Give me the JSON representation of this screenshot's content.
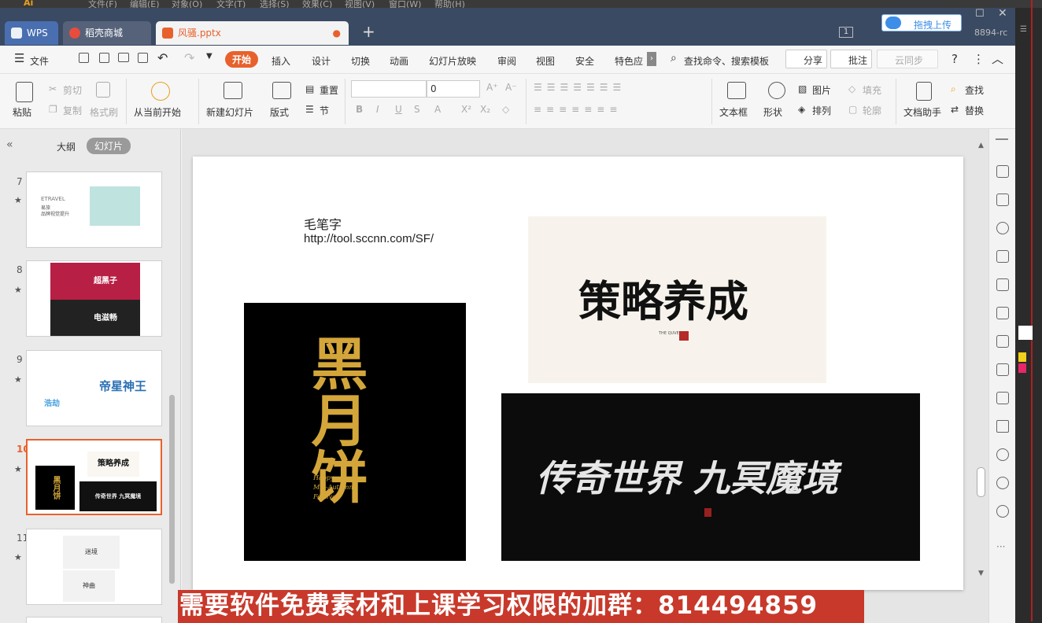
{
  "top_app_menu": [
    "文件(F)",
    "编辑(E)",
    "对象(O)",
    "文字(T)",
    "选择(S)",
    "效果(C)",
    "视图(V)",
    "窗口(W)",
    "帮助(H)"
  ],
  "tabs": [
    {
      "label": "WPS"
    },
    {
      "label": "稻壳商城"
    },
    {
      "label": "风骚.pptx"
    }
  ],
  "titlebar": {
    "upload_label": "拖拽上传",
    "badge": "1",
    "rc_text": "8894-rc"
  },
  "menu": {
    "file": "文件",
    "items": [
      "开始",
      "插入",
      "设计",
      "切换",
      "动画",
      "幻灯片放映",
      "审阅",
      "视图",
      "安全",
      "特色应"
    ],
    "search": "查找命令、搜索模板",
    "share": "分享",
    "comment": "批注",
    "cloud": "云同步"
  },
  "ribbon": {
    "paste": "粘贴",
    "cut": "剪切",
    "copy": "复制",
    "format_painter": "格式刷",
    "from_current": "从当前开始",
    "new_slide": "新建幻灯片",
    "layout": "版式",
    "reset": "重置",
    "section": "节",
    "font_size": "0",
    "textbox": "文本框",
    "shape": "形状",
    "picture": "图片",
    "arrange": "排列",
    "fill": "填充",
    "outline": "轮廓",
    "doc_assistant": "文档助手",
    "find": "查找",
    "replace": "替换"
  },
  "left_pane": {
    "tab_outline": "大纲",
    "tab_slides": "幻灯片",
    "slides": [
      {
        "num": "7",
        "texts": [
          "ETRAVEL",
          "易旅",
          "品牌视觉提升"
        ]
      },
      {
        "num": "8",
        "texts": [
          "超黑子",
          "电滋畅"
        ]
      },
      {
        "num": "9",
        "texts": [
          "帝星神王",
          "浩劫"
        ]
      },
      {
        "num": "10",
        "texts": [
          "策略养成",
          "黑月饼",
          "传奇世界 九冥魔境"
        ]
      },
      {
        "num": "11",
        "texts": [
          "迷境",
          "神曲"
        ]
      }
    ]
  },
  "slide": {
    "title": "毛笔字",
    "url": "http://tool.sccnn.com/SF/",
    "img_top_right_text": "策略养成",
    "img_small_caption": "THE QUVE",
    "img_left_text": "黑月饼",
    "img_left_caption": [
      "Happy",
      "Mid-Autumn",
      "Festival"
    ],
    "img_bottom_text": "传奇世界 九冥魔境"
  },
  "banner": "需要软件免费素材和上课学习权限的加群：814494859",
  "colors": {
    "accent": "#e8612c",
    "tabbar": "#3a4a63",
    "banner": "#c8392b",
    "gold": "#d4a63a"
  }
}
